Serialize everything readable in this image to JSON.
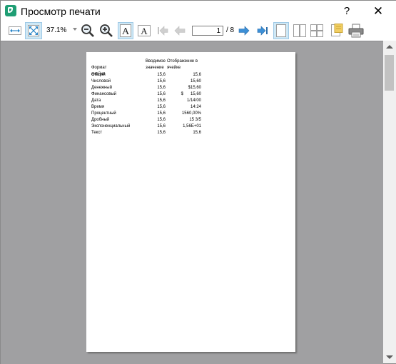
{
  "window": {
    "title": "Просмотр печати",
    "help_label": "?",
    "close_label": "✕"
  },
  "toolbar": {
    "zoom_value": "37.1%",
    "page_current": "1",
    "page_total": "/ 8",
    "icons": [
      "fit-width-icon",
      "fit-page-icon",
      "zoom-out-icon",
      "zoom-in-icon",
      "font-increase-icon",
      "font-decrease-icon",
      "first-page-icon",
      "previous-page-icon",
      "next-page-icon",
      "last-page-icon",
      "single-page-icon",
      "two-pages-icon",
      "four-pages-icon",
      "page-setup-icon",
      "print-icon"
    ]
  },
  "sheet": {
    "headers": {
      "format": "Формат ячейки",
      "input_line1": "Вводимое",
      "input_line2": "значение",
      "display_line1": "Отображение в",
      "display_line2": "ячейке"
    },
    "rows": [
      {
        "format": "Общий",
        "input": "15,6",
        "display": "15,6"
      },
      {
        "format": "Числовой",
        "input": "15,6",
        "display": "15,60"
      },
      {
        "format": "Денежный",
        "input": "15,6",
        "display": "$15,60"
      },
      {
        "format": "Финансовый",
        "input": "15,6",
        "display": "$      15,60"
      },
      {
        "format": "Дата",
        "input": "15,6",
        "display": "1/14/00"
      },
      {
        "format": "Время",
        "input": "15,6",
        "display": "14:24"
      },
      {
        "format": "Процентный",
        "input": "15,6",
        "display": "1560,00%"
      },
      {
        "format": "Дробный",
        "input": "15,6",
        "display": "15 3/5"
      },
      {
        "format": "Экспоненциальный",
        "input": "15,6",
        "display": "1,56E+01"
      },
      {
        "format": "Текст",
        "input": "15,6",
        "display": "15,6"
      }
    ]
  },
  "colors": {
    "accent": "#1f9e74",
    "preview_bg": "#a0a0a2",
    "active_button": "#cfe8f5"
  }
}
